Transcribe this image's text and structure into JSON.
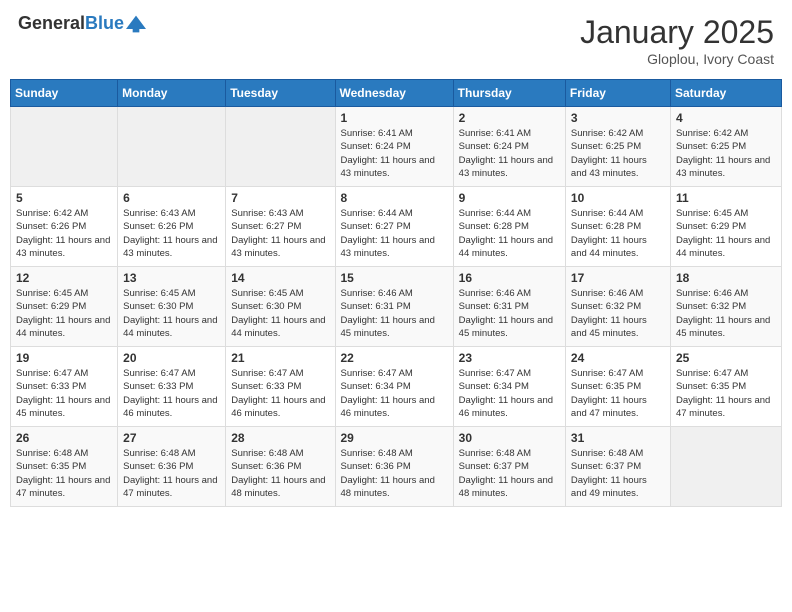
{
  "header": {
    "logo_general": "General",
    "logo_blue": "Blue",
    "month_title": "January 2025",
    "location": "Gloplou, Ivory Coast"
  },
  "weekdays": [
    "Sunday",
    "Monday",
    "Tuesday",
    "Wednesday",
    "Thursday",
    "Friday",
    "Saturday"
  ],
  "weeks": [
    [
      {
        "day": "",
        "sunrise": "",
        "sunset": "",
        "daylight": ""
      },
      {
        "day": "",
        "sunrise": "",
        "sunset": "",
        "daylight": ""
      },
      {
        "day": "",
        "sunrise": "",
        "sunset": "",
        "daylight": ""
      },
      {
        "day": "1",
        "sunrise": "Sunrise: 6:41 AM",
        "sunset": "Sunset: 6:24 PM",
        "daylight": "Daylight: 11 hours and 43 minutes."
      },
      {
        "day": "2",
        "sunrise": "Sunrise: 6:41 AM",
        "sunset": "Sunset: 6:24 PM",
        "daylight": "Daylight: 11 hours and 43 minutes."
      },
      {
        "day": "3",
        "sunrise": "Sunrise: 6:42 AM",
        "sunset": "Sunset: 6:25 PM",
        "daylight": "Daylight: 11 hours and 43 minutes."
      },
      {
        "day": "4",
        "sunrise": "Sunrise: 6:42 AM",
        "sunset": "Sunset: 6:25 PM",
        "daylight": "Daylight: 11 hours and 43 minutes."
      }
    ],
    [
      {
        "day": "5",
        "sunrise": "Sunrise: 6:42 AM",
        "sunset": "Sunset: 6:26 PM",
        "daylight": "Daylight: 11 hours and 43 minutes."
      },
      {
        "day": "6",
        "sunrise": "Sunrise: 6:43 AM",
        "sunset": "Sunset: 6:26 PM",
        "daylight": "Daylight: 11 hours and 43 minutes."
      },
      {
        "day": "7",
        "sunrise": "Sunrise: 6:43 AM",
        "sunset": "Sunset: 6:27 PM",
        "daylight": "Daylight: 11 hours and 43 minutes."
      },
      {
        "day": "8",
        "sunrise": "Sunrise: 6:44 AM",
        "sunset": "Sunset: 6:27 PM",
        "daylight": "Daylight: 11 hours and 43 minutes."
      },
      {
        "day": "9",
        "sunrise": "Sunrise: 6:44 AM",
        "sunset": "Sunset: 6:28 PM",
        "daylight": "Daylight: 11 hours and 44 minutes."
      },
      {
        "day": "10",
        "sunrise": "Sunrise: 6:44 AM",
        "sunset": "Sunset: 6:28 PM",
        "daylight": "Daylight: 11 hours and 44 minutes."
      },
      {
        "day": "11",
        "sunrise": "Sunrise: 6:45 AM",
        "sunset": "Sunset: 6:29 PM",
        "daylight": "Daylight: 11 hours and 44 minutes."
      }
    ],
    [
      {
        "day": "12",
        "sunrise": "Sunrise: 6:45 AM",
        "sunset": "Sunset: 6:29 PM",
        "daylight": "Daylight: 11 hours and 44 minutes."
      },
      {
        "day": "13",
        "sunrise": "Sunrise: 6:45 AM",
        "sunset": "Sunset: 6:30 PM",
        "daylight": "Daylight: 11 hours and 44 minutes."
      },
      {
        "day": "14",
        "sunrise": "Sunrise: 6:45 AM",
        "sunset": "Sunset: 6:30 PM",
        "daylight": "Daylight: 11 hours and 44 minutes."
      },
      {
        "day": "15",
        "sunrise": "Sunrise: 6:46 AM",
        "sunset": "Sunset: 6:31 PM",
        "daylight": "Daylight: 11 hours and 45 minutes."
      },
      {
        "day": "16",
        "sunrise": "Sunrise: 6:46 AM",
        "sunset": "Sunset: 6:31 PM",
        "daylight": "Daylight: 11 hours and 45 minutes."
      },
      {
        "day": "17",
        "sunrise": "Sunrise: 6:46 AM",
        "sunset": "Sunset: 6:32 PM",
        "daylight": "Daylight: 11 hours and 45 minutes."
      },
      {
        "day": "18",
        "sunrise": "Sunrise: 6:46 AM",
        "sunset": "Sunset: 6:32 PM",
        "daylight": "Daylight: 11 hours and 45 minutes."
      }
    ],
    [
      {
        "day": "19",
        "sunrise": "Sunrise: 6:47 AM",
        "sunset": "Sunset: 6:33 PM",
        "daylight": "Daylight: 11 hours and 45 minutes."
      },
      {
        "day": "20",
        "sunrise": "Sunrise: 6:47 AM",
        "sunset": "Sunset: 6:33 PM",
        "daylight": "Daylight: 11 hours and 46 minutes."
      },
      {
        "day": "21",
        "sunrise": "Sunrise: 6:47 AM",
        "sunset": "Sunset: 6:33 PM",
        "daylight": "Daylight: 11 hours and 46 minutes."
      },
      {
        "day": "22",
        "sunrise": "Sunrise: 6:47 AM",
        "sunset": "Sunset: 6:34 PM",
        "daylight": "Daylight: 11 hours and 46 minutes."
      },
      {
        "day": "23",
        "sunrise": "Sunrise: 6:47 AM",
        "sunset": "Sunset: 6:34 PM",
        "daylight": "Daylight: 11 hours and 46 minutes."
      },
      {
        "day": "24",
        "sunrise": "Sunrise: 6:47 AM",
        "sunset": "Sunset: 6:35 PM",
        "daylight": "Daylight: 11 hours and 47 minutes."
      },
      {
        "day": "25",
        "sunrise": "Sunrise: 6:47 AM",
        "sunset": "Sunset: 6:35 PM",
        "daylight": "Daylight: 11 hours and 47 minutes."
      }
    ],
    [
      {
        "day": "26",
        "sunrise": "Sunrise: 6:48 AM",
        "sunset": "Sunset: 6:35 PM",
        "daylight": "Daylight: 11 hours and 47 minutes."
      },
      {
        "day": "27",
        "sunrise": "Sunrise: 6:48 AM",
        "sunset": "Sunset: 6:36 PM",
        "daylight": "Daylight: 11 hours and 47 minutes."
      },
      {
        "day": "28",
        "sunrise": "Sunrise: 6:48 AM",
        "sunset": "Sunset: 6:36 PM",
        "daylight": "Daylight: 11 hours and 48 minutes."
      },
      {
        "day": "29",
        "sunrise": "Sunrise: 6:48 AM",
        "sunset": "Sunset: 6:36 PM",
        "daylight": "Daylight: 11 hours and 48 minutes."
      },
      {
        "day": "30",
        "sunrise": "Sunrise: 6:48 AM",
        "sunset": "Sunset: 6:37 PM",
        "daylight": "Daylight: 11 hours and 48 minutes."
      },
      {
        "day": "31",
        "sunrise": "Sunrise: 6:48 AM",
        "sunset": "Sunset: 6:37 PM",
        "daylight": "Daylight: 11 hours and 49 minutes."
      },
      {
        "day": "",
        "sunrise": "",
        "sunset": "",
        "daylight": ""
      }
    ]
  ]
}
